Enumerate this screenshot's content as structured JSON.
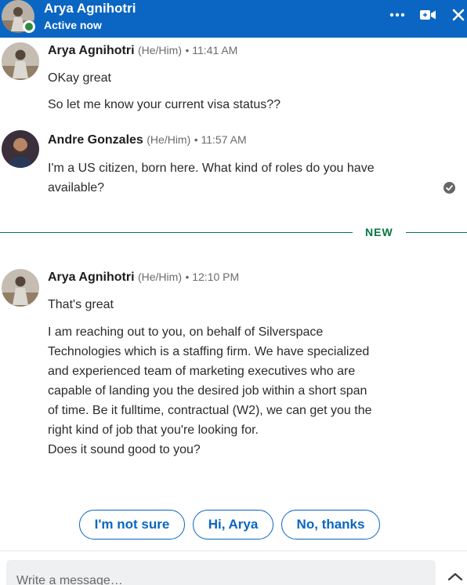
{
  "header": {
    "name": "Arya Agnihotri",
    "status": "Active now",
    "icons": [
      "more-icon",
      "video-call-icon",
      "close-icon"
    ]
  },
  "messages": [
    {
      "sender": "Arya Agnihotri",
      "pronouns": "(He/Him)",
      "time": "• 11:41 AM",
      "lines": [
        "OKay great",
        "So let me know your current visa status??"
      ]
    },
    {
      "sender": "Andre Gonzales",
      "pronouns": "(He/Him)",
      "time": "• 11:57 AM",
      "lines": [
        "I'm a US citizen, born here. What kind of roles do you have",
        "available?"
      ]
    },
    {
      "sender": "Arya Agnihotri",
      "pronouns": "(He/Him)",
      "time": "• 12:10 PM",
      "lines": [
        "That's great",
        "I am reaching out to you, on behalf of Silverspace",
        "Technologies which is a staffing firm. We have specialized",
        "and experienced team of marketing executives who are",
        "capable of landing you the desired job within a short span",
        "of time. Be it fulltime, contractual (W2), we can get you the",
        "right kind of job that you're looking for.",
        "Does it sound good to you?"
      ]
    }
  ],
  "divider_label": "NEW",
  "quick_replies": [
    "I'm not sure",
    "Hi, Arya",
    "No, thanks"
  ],
  "composer": {
    "placeholder": "Write a message…"
  },
  "colors": {
    "brand": "#0a66c2",
    "new_divider": "#057642",
    "presence": "#2e8b3d"
  }
}
